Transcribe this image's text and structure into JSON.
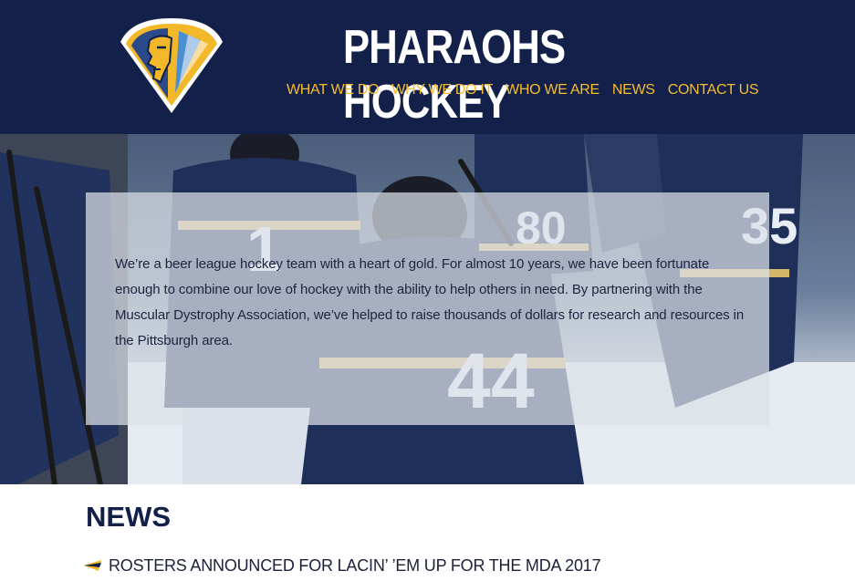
{
  "site": {
    "title": "PHARAOHS HOCKEY",
    "logo_icon": "pharaoh-shield-logo-icon"
  },
  "nav": {
    "items": [
      {
        "label": "WHAT WE DO"
      },
      {
        "label": "WHY WE DO IT"
      },
      {
        "label": "WHO WE ARE"
      },
      {
        "label": "NEWS"
      },
      {
        "label": "CONTACT US"
      }
    ]
  },
  "hero": {
    "jersey_numbers": [
      "1",
      "80",
      "35",
      "44"
    ],
    "intro": "We’re a beer league hockey team with a heart of gold. For almost 10 years, we have been fortunate enough to combine our love of hockey with the ability to help others in need. By partnering with the Muscular Dystrophy Association, we’ve helped to raise thousands of dollars for research and resources in the Pittsburgh area."
  },
  "news": {
    "heading": "NEWS",
    "bullet_icon": "pennant-bullet-icon",
    "items": [
      {
        "title": "ROSTERS ANNOUNCED FOR LACIN’ ’EM UP FOR THE MDA 2017"
      }
    ]
  },
  "colors": {
    "navy": "#12204a",
    "gold": "#f7bd2e",
    "text_dark": "#1d2440"
  }
}
